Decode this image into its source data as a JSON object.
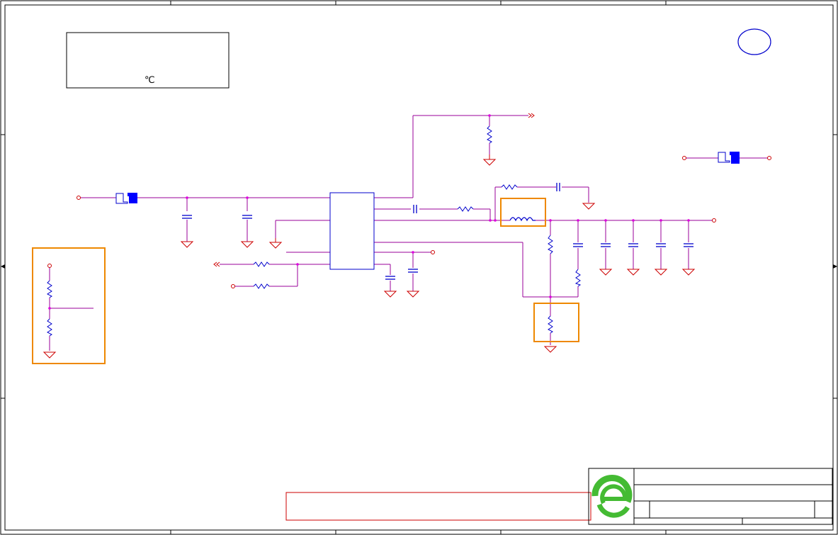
{
  "notes_box": {
    "degree_symbol": "℃"
  },
  "colors": {
    "border": "#000000",
    "wire": "#990099",
    "component": "#0000cc",
    "ground": "#cc0000",
    "highlight": "#ee8800",
    "warning_box": "#cc0000",
    "logo_green": "#44bb33",
    "connector_fill": "#0000ff"
  },
  "icons": {
    "title_block_logo": "e-logo-icon",
    "revision_marker": "circle-icon",
    "connector": "connector-icon",
    "ground": "ground-icon"
  }
}
